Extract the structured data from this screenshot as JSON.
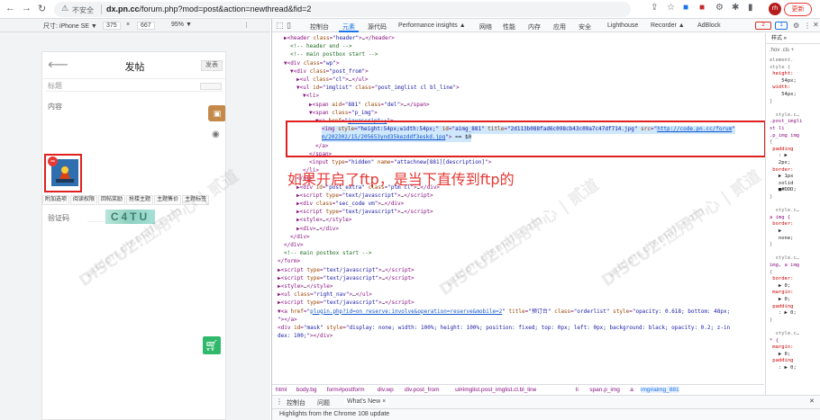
{
  "browser": {
    "insecure_label": "不安全",
    "url_host": "dx.pn.cc",
    "url_path": "/forum.php?mod=post&action=newthread&fid=2",
    "avatar_initials": "rh",
    "update_label": "更新"
  },
  "device_toolbar": {
    "size_label": "尺寸: iPhone SE ▼",
    "width": "375",
    "times": "×",
    "height": "667",
    "zoom": "95% ▼"
  },
  "phone": {
    "title": "发帖",
    "post_button": "发表",
    "subject_placeholder": "标题",
    "content_label": "内容",
    "tabs": [
      "附加选项",
      "阅读权限",
      "回帖奖励",
      "抢楼主题",
      "主题售价",
      "主题标签"
    ],
    "captcha_label": "验证码",
    "captcha_text": "C4TU"
  },
  "devtools": {
    "tabs": [
      "控制台",
      "元素",
      "源代码",
      "Performance insights ▲",
      "网络",
      "性能",
      "内存",
      "应用",
      "安全",
      "Lighthouse",
      "Recorder ▲",
      "AdBlock"
    ],
    "active_tab": "元素",
    "error_count": "2",
    "message_count": "1",
    "dom_lines": [
      {
        "indent": 1,
        "html": "<span class='tg'>▶</span>&lt;header <span class='at'>class</span>=<span class='av'>\"header\"</span>&gt;<span class='tx'>…</span>&lt;/header&gt;"
      },
      {
        "indent": 2,
        "html": "<span class='cm'>&lt;!-- header end --&gt;</span>"
      },
      {
        "indent": 2,
        "html": "<span class='cm'>&lt;!-- main postbox start --&gt;</span>"
      },
      {
        "indent": 1,
        "html": "▼&lt;div <span class='at'>class</span>=<span class='av'>\"wp\"</span>&gt;"
      },
      {
        "indent": 2,
        "html": "▼&lt;div <span class='at'>class</span>=<span class='av'>\"post_from\"</span>&gt;"
      },
      {
        "indent": 3,
        "html": "▶&lt;ul <span class='at'>class</span>=<span class='av'>\"cl\"</span>&gt;<span class='tx'>…</span>&lt;/ul&gt;"
      },
      {
        "indent": 3,
        "html": "▼&lt;ul <span class='at'>id</span>=<span class='av'>\"imglist\"</span> <span class='at'>class</span>=<span class='av'>\"post_imglist cl bl_line\"</span>&gt;"
      },
      {
        "indent": 4,
        "html": "▼&lt;li&gt;"
      },
      {
        "indent": 5,
        "html": "▶&lt;span <span class='at'>aid</span>=<span class='av'>\"881\"</span> <span class='at'>class</span>=<span class='av'>\"del\"</span>&gt;<span class='tx'>…</span>&lt;/span&gt;"
      },
      {
        "indent": 5,
        "html": "▼&lt;span <span class='at'>class</span>=<span class='av'>\"p_img\"</span>&gt;"
      },
      {
        "indent": 6,
        "html": "▼&lt;a <span class='at'>href</span>=<span class='av'>\"<span class='lk'>javascript:;</span>\"</span>&gt;"
      },
      {
        "indent": 7,
        "html": "&lt;img <span class='at'>style</span>=<span class='av'>\"height:54px;width:54px;\"</span> <span class='at'>id</span>=<span class='av'>\"aimg_881\"</span> <span class='at'>title</span>=<span class='av'>\"2d113b088fad6c098cb43c09a7c47df714.jpg\"</span> <span class='at'>src</span>=<span class='av'>\"<span class='lk'>http://code.pn.cc/forum</span>\"</span>"
      },
      {
        "indent": 7,
        "html": "<span class='av'><span class='lk'>m/202302/15/205653ynd35kezddf3eskd.jpg</span>\"</span>&gt; <span class='tx'>== $0</span>"
      },
      {
        "indent": 6,
        "html": "&lt;/a&gt;"
      },
      {
        "indent": 5,
        "html": "&lt;/span&gt;"
      },
      {
        "indent": 5,
        "html": "&lt;input <span class='at'>type</span>=<span class='av'>\"hidden\"</span> <span class='at'>name</span>=<span class='av'>\"attachnew[881][description]\"</span>&gt;"
      },
      {
        "indent": 4,
        "html": "&lt;/li&gt;"
      },
      {
        "indent": 3,
        "html": "&lt;/ul&gt;"
      },
      {
        "indent": 3,
        "html": "▶&lt;div <span class='at'>id</span>=<span class='av'>\"post_extra\"</span> <span class='at'>class</span>=<span class='av'>\"ptm cl\"</span>&gt;<span class='tx'>…</span>&lt;/div&gt;"
      },
      {
        "indent": 3,
        "html": "▶&lt;script <span class='at'>type</span>=<span class='av'>\"text/javascript\"</span>&gt;<span class='tx'>…</span>&lt;/script&gt;"
      },
      {
        "indent": 3,
        "html": "▶&lt;div <span class='at'>class</span>=<span class='av'>\"sec_code vm\"</span>&gt;<span class='tx'>…</span>&lt;/div&gt;"
      },
      {
        "indent": 3,
        "html": "▶&lt;script <span class='at'>type</span>=<span class='av'>\"text/javascript\"</span>&gt;<span class='tx'>…</span>&lt;/script&gt;"
      },
      {
        "indent": 3,
        "html": "▶&lt;style&gt;<span class='tx'>…</span>&lt;/style&gt;"
      },
      {
        "indent": 3,
        "html": "▶&lt;div&gt;<span class='tx'>…</span>&lt;/div&gt;"
      },
      {
        "indent": 2,
        "html": "&lt;/div&gt;"
      },
      {
        "indent": 1,
        "html": "&lt;/div&gt;"
      },
      {
        "indent": 1,
        "html": "<span class='cm'>&lt;!-- main postbox start --&gt;</span>"
      },
      {
        "indent": 0,
        "html": "&lt;/form&gt;"
      },
      {
        "indent": 0,
        "html": "▶&lt;script <span class='at'>type</span>=<span class='av'>\"text/javascript\"</span>&gt;<span class='tx'>…</span>&lt;/script&gt;"
      },
      {
        "indent": 0,
        "html": "▶&lt;script <span class='at'>type</span>=<span class='av'>\"text/javascript\"</span>&gt;<span class='tx'>…</span>&lt;/script&gt;"
      },
      {
        "indent": 0,
        "html": "▶&lt;style&gt;<span class='tx'>…</span>&lt;/style&gt;"
      },
      {
        "indent": 0,
        "html": "▶&lt;ul <span class='at'>class</span>=<span class='av'>\"right_nav\"</span>&gt;<span class='tx'>…</span>&lt;/ul&gt;"
      },
      {
        "indent": 0,
        "html": "▶&lt;script <span class='at'>type</span>=<span class='av'>\"text/javascript\"</span>&gt;<span class='tx'>…</span>&lt;/script&gt;"
      },
      {
        "indent": 0,
        "html": "▼&lt;a <span class='at'>href</span>=<span class='av'>\"<span class='lk'>plugin.php?id=on_reserve:involve&amp;operation=reserve&amp;mobile=2</span>\"</span> <span class='at'>title</span>=<span class='av'>\"预订台\"</span> <span class='at'>class</span>=<span class='av'>\"orderlist\"</span> <span class='at'>style</span>=<span class='av'>\"opacity: 0.618; bottom: 48px;</span>"
      },
      {
        "indent": 0,
        "html": "<span class='av'>\"</span>&gt;&lt;/a&gt;"
      },
      {
        "indent": 0,
        "html": "&lt;div <span class='at'>id</span>=<span class='av'>\"mask\"</span> <span class='at'>style</span>=<span class='av'>\"display: none; width: 100%; height: 100%; position: fixed; top: 0px; left: 0px; background: black; opacity: 0.2; z-in</span>"
      },
      {
        "indent": 0,
        "html": "<span class='av'>dex: 100;\"</span>&gt;&lt;/div&gt;"
      }
    ],
    "annotation": "如果开启了ftp，是当下直传到ftp的",
    "breadcrumbs": [
      "html",
      "body.bg",
      "form#postform",
      "div.wp",
      "div.post_from",
      "ul#imglist.post_imglist.cl.bl_line",
      "li",
      "span.p_img",
      "a",
      "img#aimg_881"
    ],
    "styles_tabs": "样式  »",
    "styles_filter": ":hov  .cls  +",
    "styles_lines": [
      {
        "c": "gr",
        "t": "element."
      },
      {
        "c": "gr",
        "t": "style {"
      },
      {
        "c": "p",
        "t": " height:"
      },
      {
        "c": "",
        "t": "    54px;"
      },
      {
        "c": "p",
        "t": " width:"
      },
      {
        "c": "",
        "t": "    54px;"
      },
      {
        "c": "gr",
        "t": "}"
      },
      {
        "c": "",
        "t": ""
      },
      {
        "c": "gr",
        "t": "  style.c…"
      },
      {
        "c": "s",
        "t": ".post_imgli"
      },
      {
        "c": "s",
        "t": "st li"
      },
      {
        "c": "s",
        "t": ".p_img img"
      },
      {
        "c": "gr",
        "t": "{"
      },
      {
        "c": "p",
        "t": " padding"
      },
      {
        "c": "",
        "t": "   : ▶"
      },
      {
        "c": "",
        "t": "   2px;"
      },
      {
        "c": "p",
        "t": " border:"
      },
      {
        "c": "",
        "t": "   ▶ 1px"
      },
      {
        "c": "",
        "t": "   solid"
      },
      {
        "c": "",
        "t": "   ■#DDD;"
      },
      {
        "c": "gr",
        "t": "}"
      },
      {
        "c": "",
        "t": ""
      },
      {
        "c": "gr",
        "t": "  style.c…"
      },
      {
        "c": "s",
        "t": "a img {"
      },
      {
        "c": "p",
        "t": " border:"
      },
      {
        "c": "",
        "t": "   ▶"
      },
      {
        "c": "",
        "t": "   none;"
      },
      {
        "c": "gr",
        "t": "}"
      },
      {
        "c": "",
        "t": ""
      },
      {
        "c": "gr",
        "t": "  style.c…"
      },
      {
        "c": "s",
        "t": "img, a img"
      },
      {
        "c": "gr",
        "t": "{"
      },
      {
        "c": "p",
        "t": " border:"
      },
      {
        "c": "",
        "t": "   ▶ 0;"
      },
      {
        "c": "p",
        "t": " margin:"
      },
      {
        "c": "",
        "t": "   ▶ 0;"
      },
      {
        "c": "p",
        "t": " padding"
      },
      {
        "c": "",
        "t": "   : ▶ 0;"
      },
      {
        "c": "gr",
        "t": "}"
      },
      {
        "c": "",
        "t": ""
      },
      {
        "c": "gr",
        "t": "  style.c…"
      },
      {
        "c": "s",
        "t": "* {"
      },
      {
        "c": "p",
        "t": " margin:"
      },
      {
        "c": "",
        "t": "   ▶ 0;"
      },
      {
        "c": "p",
        "t": " padding"
      },
      {
        "c": "",
        "t": "   : ▶ 0;"
      }
    ],
    "drawer_tabs": [
      "控制台",
      "问题",
      "What's New ×"
    ],
    "drawer_message": "Highlights from the Chrome 108 update"
  },
  "watermarks": [
    "DISCUZ!应用中心 | 贰道",
    "addon.dismall.com"
  ]
}
